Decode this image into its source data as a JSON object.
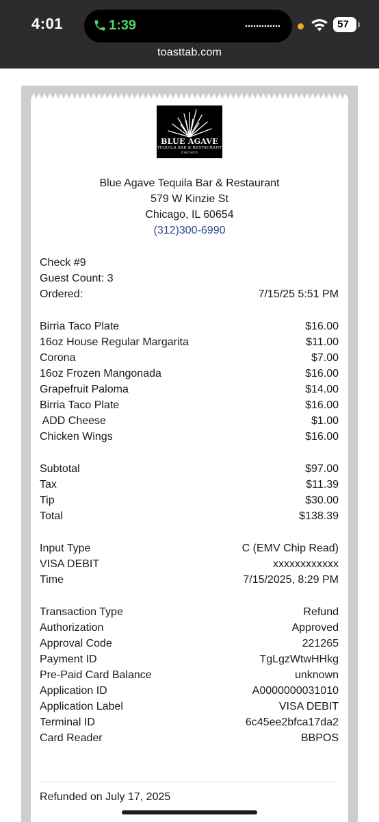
{
  "status_bar": {
    "time": "4:01",
    "call_timer": "1:39",
    "battery": "57",
    "url": "toasttab.com",
    "call_color": "#4cd964",
    "indicator_color": "#f5a623"
  },
  "restaurant": {
    "logo": {
      "name": "BLUE AGAVE",
      "subtitle": "TEQUILA BAR & RESTAURANT",
      "city": "CHICAGO"
    },
    "name": "Blue Agave Tequila Bar & Restaurant",
    "address_line1": "579 W Kinzie St",
    "address_line2": "Chicago, IL 60654",
    "phone": "(312)300-6990"
  },
  "check_info": {
    "check_number": "Check #9",
    "guest_count": "Guest Count: 3",
    "ordered_label": "Ordered:",
    "ordered_value": "7/15/25 5:51 PM"
  },
  "items": [
    {
      "name": "Birria Taco Plate",
      "price": "$16.00"
    },
    {
      "name": "16oz House Regular Margarita",
      "price": "$11.00"
    },
    {
      "name": "Corona",
      "price": "$7.00"
    },
    {
      "name": "16oz Frozen Mangonada",
      "price": "$16.00"
    },
    {
      "name": "Grapefruit Paloma",
      "price": "$14.00"
    },
    {
      "name": "Birria Taco Plate",
      "price": "$16.00"
    },
    {
      "name": " ADD Cheese",
      "price": "$1.00"
    },
    {
      "name": "Chicken Wings",
      "price": "$16.00"
    }
  ],
  "totals": [
    {
      "label": "Subtotal",
      "value": "$97.00"
    },
    {
      "label": "Tax",
      "value": "$11.39"
    },
    {
      "label": "Tip",
      "value": "$30.00"
    },
    {
      "label": "Total",
      "value": "$138.39"
    }
  ],
  "payment": [
    {
      "label": "Input Type",
      "value": "C (EMV Chip Read)"
    },
    {
      "label": "VISA DEBIT",
      "value": "xxxxxxxxxxxx"
    },
    {
      "label": "Time",
      "value": "7/15/2025, 8:29 PM"
    }
  ],
  "transaction": [
    {
      "label": "Transaction Type",
      "value": "Refund"
    },
    {
      "label": "Authorization",
      "value": "Approved"
    },
    {
      "label": "Approval Code",
      "value": "221265"
    },
    {
      "label": "Payment ID",
      "value": "TgLgzWtwHHkg"
    },
    {
      "label": "Pre-Paid Card Balance",
      "value": "unknown"
    },
    {
      "label": "Application ID",
      "value": "A0000000031010"
    },
    {
      "label": "Application Label",
      "value": "VISA DEBIT"
    },
    {
      "label": "Terminal ID",
      "value": "6c45ee2bfca17da2"
    },
    {
      "label": "Card Reader",
      "value": "BBPOS"
    }
  ],
  "refund_note": "Refunded on July 17, 2025",
  "colors": {
    "phone_link": "#2b4a8f",
    "frame": "#cdcdcd",
    "status_bar_bg": "#2c2c2e"
  }
}
